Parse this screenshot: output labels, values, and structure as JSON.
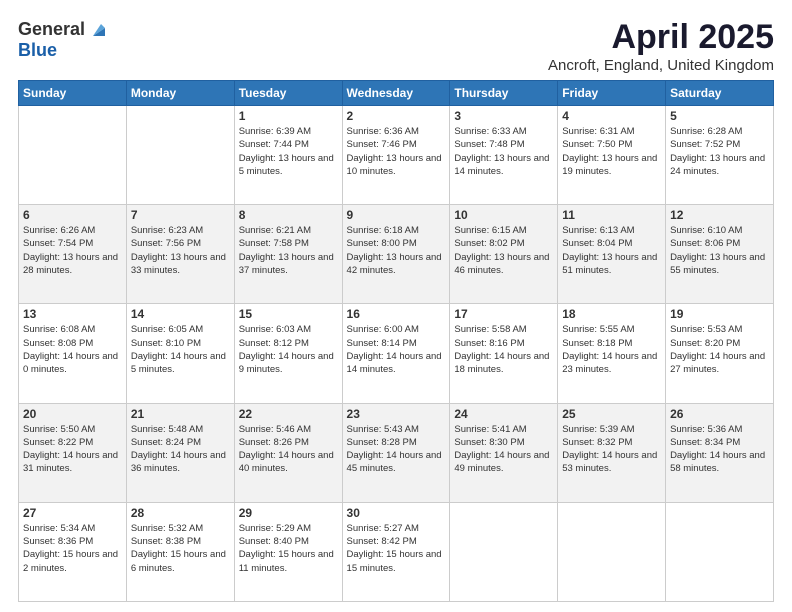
{
  "header": {
    "logo_general": "General",
    "logo_blue": "Blue",
    "month": "April 2025",
    "location": "Ancroft, England, United Kingdom"
  },
  "days_of_week": [
    "Sunday",
    "Monday",
    "Tuesday",
    "Wednesday",
    "Thursday",
    "Friday",
    "Saturday"
  ],
  "weeks": [
    [
      {
        "day": "",
        "info": ""
      },
      {
        "day": "",
        "info": ""
      },
      {
        "day": "1",
        "info": "Sunrise: 6:39 AM\nSunset: 7:44 PM\nDaylight: 13 hours and 5 minutes."
      },
      {
        "day": "2",
        "info": "Sunrise: 6:36 AM\nSunset: 7:46 PM\nDaylight: 13 hours and 10 minutes."
      },
      {
        "day": "3",
        "info": "Sunrise: 6:33 AM\nSunset: 7:48 PM\nDaylight: 13 hours and 14 minutes."
      },
      {
        "day": "4",
        "info": "Sunrise: 6:31 AM\nSunset: 7:50 PM\nDaylight: 13 hours and 19 minutes."
      },
      {
        "day": "5",
        "info": "Sunrise: 6:28 AM\nSunset: 7:52 PM\nDaylight: 13 hours and 24 minutes."
      }
    ],
    [
      {
        "day": "6",
        "info": "Sunrise: 6:26 AM\nSunset: 7:54 PM\nDaylight: 13 hours and 28 minutes."
      },
      {
        "day": "7",
        "info": "Sunrise: 6:23 AM\nSunset: 7:56 PM\nDaylight: 13 hours and 33 minutes."
      },
      {
        "day": "8",
        "info": "Sunrise: 6:21 AM\nSunset: 7:58 PM\nDaylight: 13 hours and 37 minutes."
      },
      {
        "day": "9",
        "info": "Sunrise: 6:18 AM\nSunset: 8:00 PM\nDaylight: 13 hours and 42 minutes."
      },
      {
        "day": "10",
        "info": "Sunrise: 6:15 AM\nSunset: 8:02 PM\nDaylight: 13 hours and 46 minutes."
      },
      {
        "day": "11",
        "info": "Sunrise: 6:13 AM\nSunset: 8:04 PM\nDaylight: 13 hours and 51 minutes."
      },
      {
        "day": "12",
        "info": "Sunrise: 6:10 AM\nSunset: 8:06 PM\nDaylight: 13 hours and 55 minutes."
      }
    ],
    [
      {
        "day": "13",
        "info": "Sunrise: 6:08 AM\nSunset: 8:08 PM\nDaylight: 14 hours and 0 minutes."
      },
      {
        "day": "14",
        "info": "Sunrise: 6:05 AM\nSunset: 8:10 PM\nDaylight: 14 hours and 5 minutes."
      },
      {
        "day": "15",
        "info": "Sunrise: 6:03 AM\nSunset: 8:12 PM\nDaylight: 14 hours and 9 minutes."
      },
      {
        "day": "16",
        "info": "Sunrise: 6:00 AM\nSunset: 8:14 PM\nDaylight: 14 hours and 14 minutes."
      },
      {
        "day": "17",
        "info": "Sunrise: 5:58 AM\nSunset: 8:16 PM\nDaylight: 14 hours and 18 minutes."
      },
      {
        "day": "18",
        "info": "Sunrise: 5:55 AM\nSunset: 8:18 PM\nDaylight: 14 hours and 23 minutes."
      },
      {
        "day": "19",
        "info": "Sunrise: 5:53 AM\nSunset: 8:20 PM\nDaylight: 14 hours and 27 minutes."
      }
    ],
    [
      {
        "day": "20",
        "info": "Sunrise: 5:50 AM\nSunset: 8:22 PM\nDaylight: 14 hours and 31 minutes."
      },
      {
        "day": "21",
        "info": "Sunrise: 5:48 AM\nSunset: 8:24 PM\nDaylight: 14 hours and 36 minutes."
      },
      {
        "day": "22",
        "info": "Sunrise: 5:46 AM\nSunset: 8:26 PM\nDaylight: 14 hours and 40 minutes."
      },
      {
        "day": "23",
        "info": "Sunrise: 5:43 AM\nSunset: 8:28 PM\nDaylight: 14 hours and 45 minutes."
      },
      {
        "day": "24",
        "info": "Sunrise: 5:41 AM\nSunset: 8:30 PM\nDaylight: 14 hours and 49 minutes."
      },
      {
        "day": "25",
        "info": "Sunrise: 5:39 AM\nSunset: 8:32 PM\nDaylight: 14 hours and 53 minutes."
      },
      {
        "day": "26",
        "info": "Sunrise: 5:36 AM\nSunset: 8:34 PM\nDaylight: 14 hours and 58 minutes."
      }
    ],
    [
      {
        "day": "27",
        "info": "Sunrise: 5:34 AM\nSunset: 8:36 PM\nDaylight: 15 hours and 2 minutes."
      },
      {
        "day": "28",
        "info": "Sunrise: 5:32 AM\nSunset: 8:38 PM\nDaylight: 15 hours and 6 minutes."
      },
      {
        "day": "29",
        "info": "Sunrise: 5:29 AM\nSunset: 8:40 PM\nDaylight: 15 hours and 11 minutes."
      },
      {
        "day": "30",
        "info": "Sunrise: 5:27 AM\nSunset: 8:42 PM\nDaylight: 15 hours and 15 minutes."
      },
      {
        "day": "",
        "info": ""
      },
      {
        "day": "",
        "info": ""
      },
      {
        "day": "",
        "info": ""
      }
    ]
  ]
}
